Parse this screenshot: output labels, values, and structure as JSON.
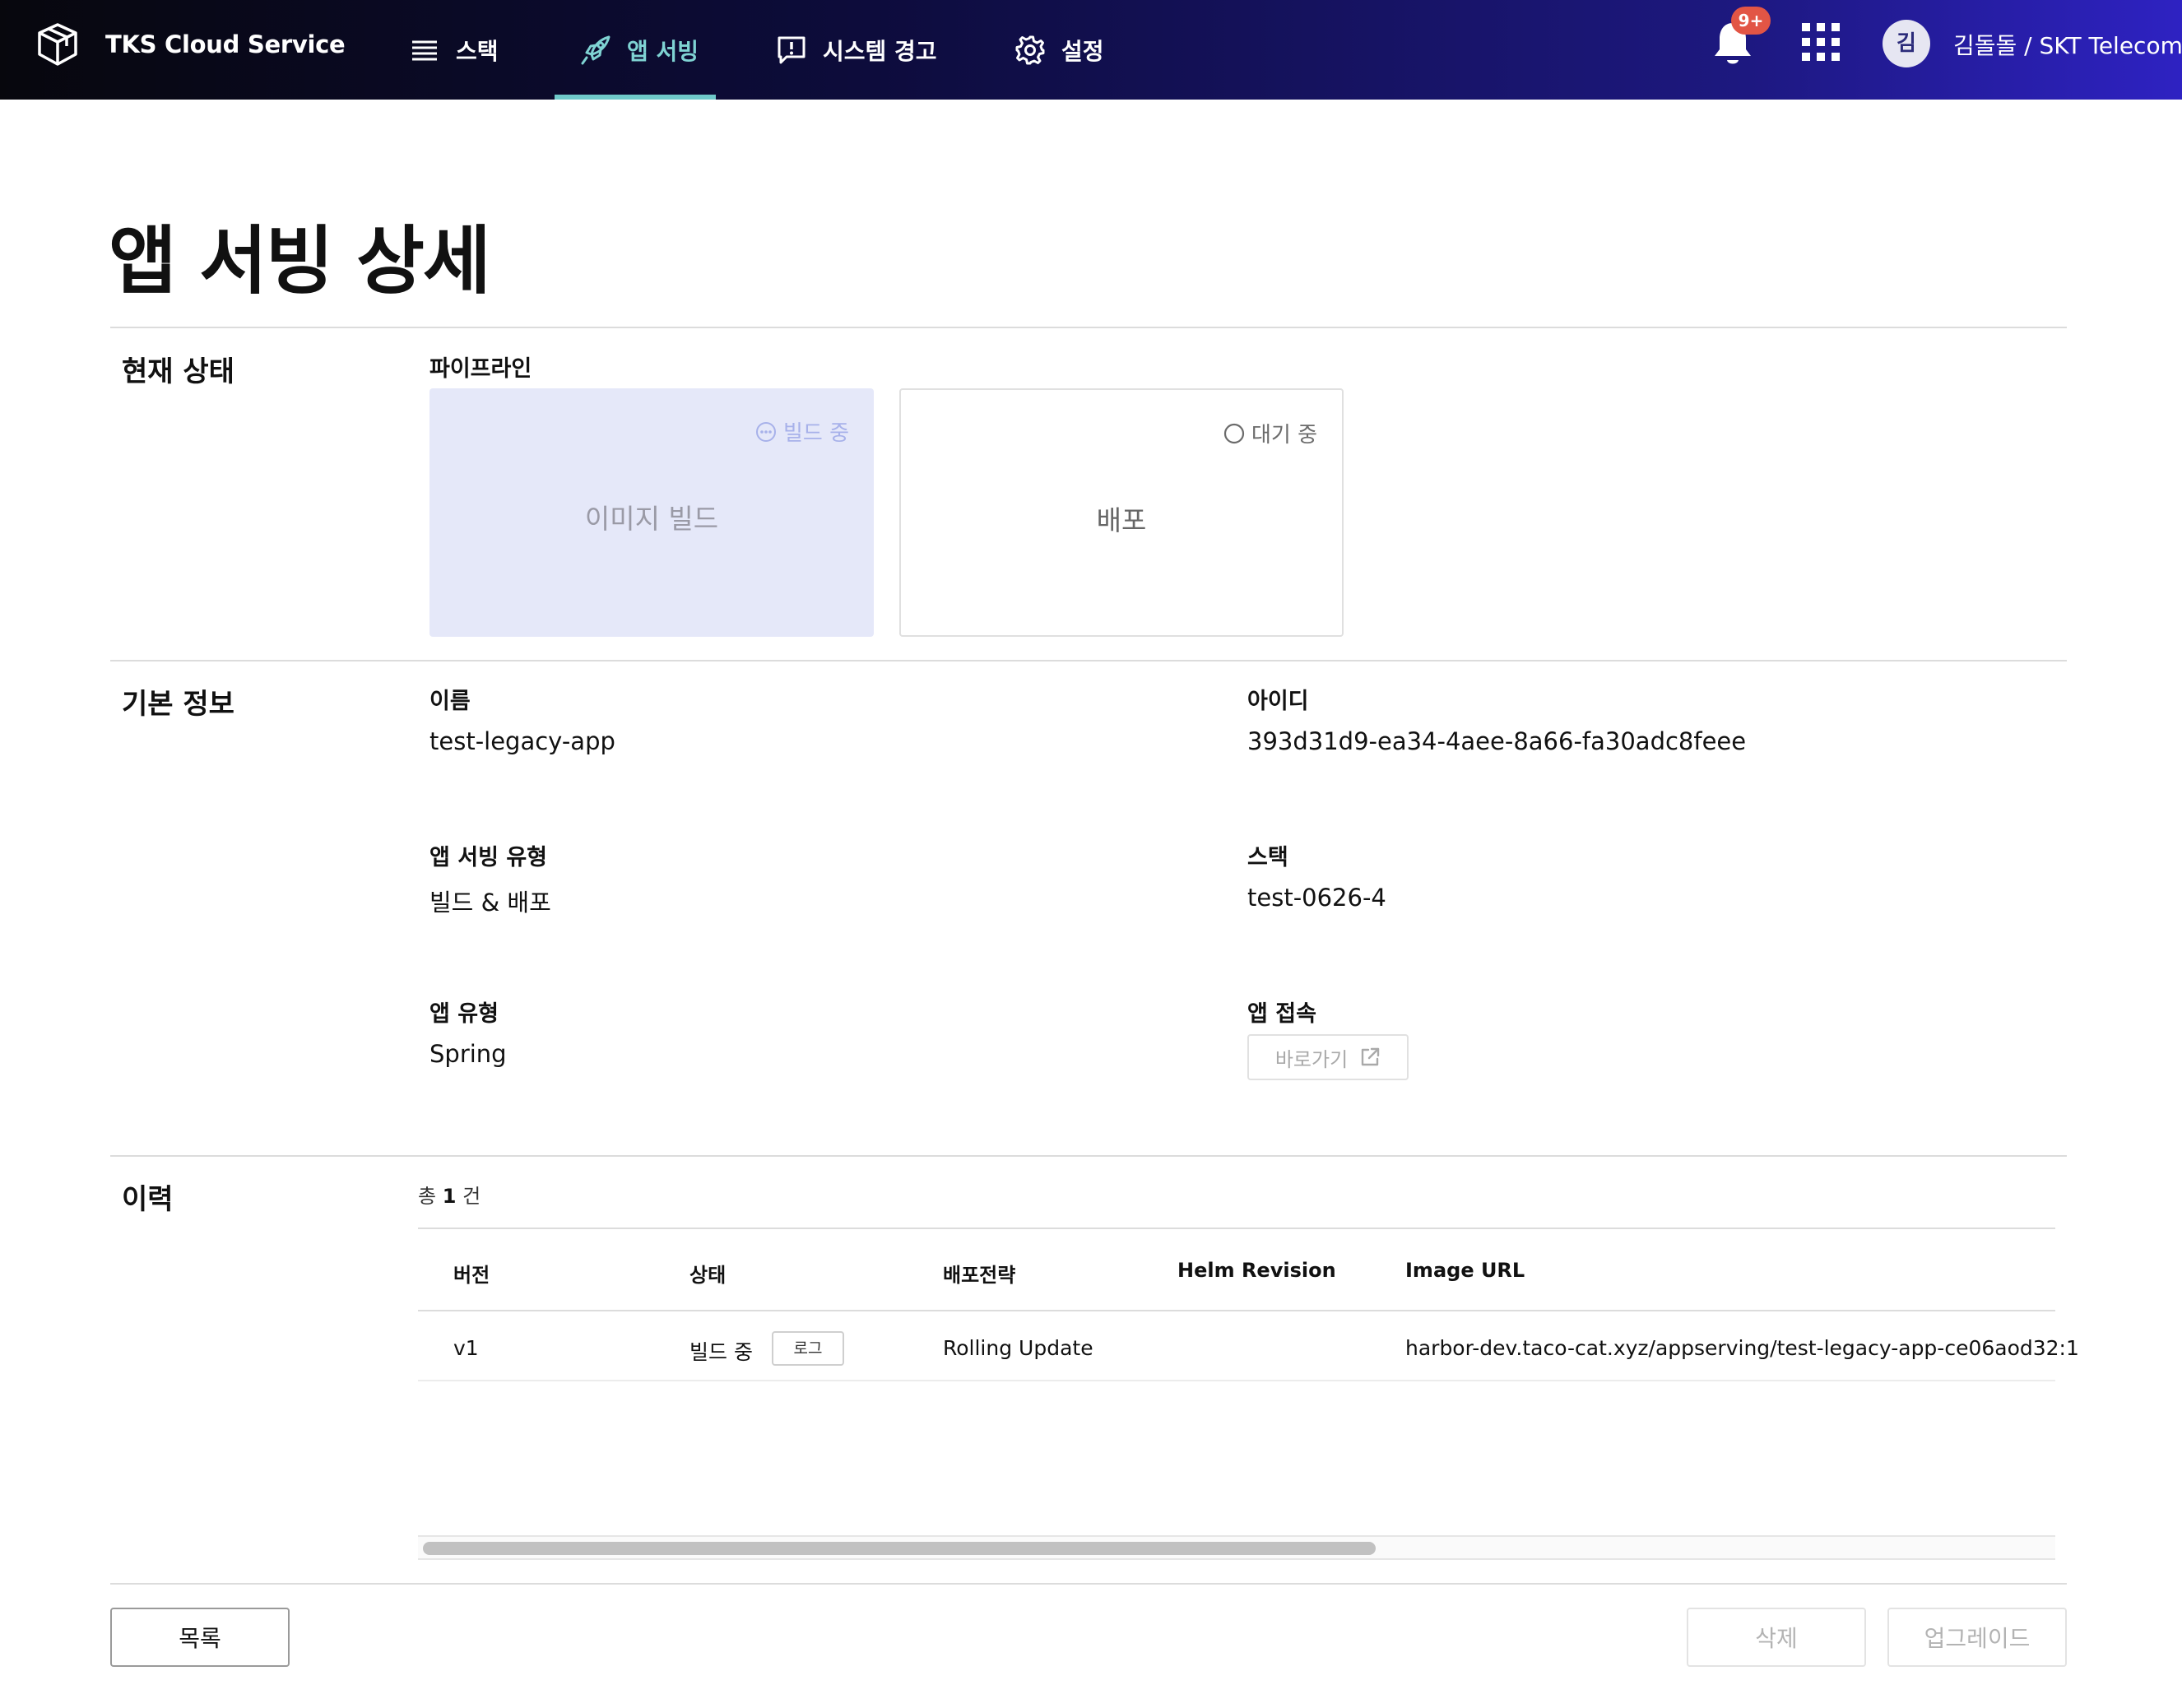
{
  "header": {
    "brand": "TKS Cloud Service",
    "nav": [
      {
        "label": "스택",
        "icon": "list-icon"
      },
      {
        "label": "앱 서빙",
        "icon": "rocket-icon",
        "active": true
      },
      {
        "label": "시스템 경고",
        "icon": "alert-message-icon"
      },
      {
        "label": "설정",
        "icon": "gear-icon"
      }
    ],
    "notification_badge": "9+",
    "avatar_initial": "김",
    "user": "김돌돌 / SKT Telecom",
    "accent_color": "#7fd3d3"
  },
  "page": {
    "title": "앱 서빙 상세"
  },
  "status_section": {
    "title": "현재 상태",
    "pipeline_label": "파이프라인",
    "stages": [
      {
        "name": "이미지 빌드",
        "status": "빌드 중",
        "status_icon": "more-circle-icon",
        "active": true
      },
      {
        "name": "배포",
        "status": "대기 중",
        "status_icon": "empty-circle-icon",
        "active": false
      }
    ]
  },
  "info_section": {
    "title": "기본 정보",
    "name_label": "이름",
    "name_value": "test-legacy-app",
    "id_label": "아이디",
    "id_value": "393d31d9-ea34-4aee-8a66-fa30adc8feee",
    "serving_type_label": "앱 서빙 유형",
    "serving_type_value": "빌드 & 배포",
    "stack_label": "스택",
    "stack_value": "test-0626-4",
    "app_type_label": "앱 유형",
    "app_type_value": "Spring",
    "access_label": "앱 접속",
    "access_button": "바로가기"
  },
  "history_section": {
    "title": "이력",
    "count_prefix": "총",
    "count": "1",
    "count_suffix": "건",
    "columns": [
      "버전",
      "상태",
      "배포전략",
      "Helm Revision",
      "Image URL"
    ],
    "rows": [
      {
        "version": "v1",
        "status": "빌드 중",
        "log_button": "로그",
        "strategy": "Rolling Update",
        "helm_revision": "",
        "image_url": "harbor-dev.taco-cat.xyz/appserving/test-legacy-app-ce06aod32:1"
      }
    ]
  },
  "footer": {
    "list_button": "목록",
    "delete_button": "삭제",
    "upgrade_button": "업그레이드"
  }
}
